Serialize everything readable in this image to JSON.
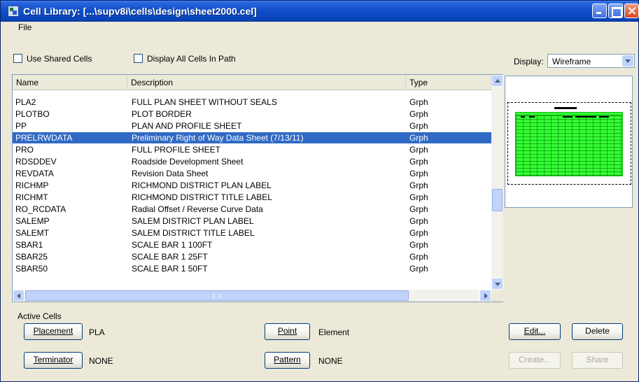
{
  "window": {
    "title": "Cell Library: [...\\supv8i\\cells\\design\\sheet2000.cel]"
  },
  "menu": {
    "file": "File"
  },
  "options": {
    "use_shared_cells": "Use Shared Cells",
    "display_all_cells": "Display All Cells In Path"
  },
  "display": {
    "label": "Display:",
    "value": "Wireframe"
  },
  "list": {
    "columns": {
      "name": "Name",
      "description": "Description",
      "type": "Type"
    },
    "rows": [
      {
        "name": "PLA2",
        "description": "FULL PLAN SHEET WITHOUT SEALS",
        "type": "Grph"
      },
      {
        "name": "PLOTBO",
        "description": "PLOT BORDER",
        "type": "Grph"
      },
      {
        "name": "PP",
        "description": "PLAN AND PROFILE SHEET",
        "type": "Grph"
      },
      {
        "name": "PRELRWDATA",
        "description": "Preliminary Right of Way Data Sheet    (7/13/11)",
        "type": "Grph",
        "selected": true
      },
      {
        "name": "PRO",
        "description": "FULL PROFILE SHEET",
        "type": "Grph"
      },
      {
        "name": "RDSDDEV",
        "description": "Roadside Development Sheet",
        "type": "Grph"
      },
      {
        "name": "REVDATA",
        "description": "Revision Data Sheet",
        "type": "Grph"
      },
      {
        "name": "RICHMP",
        "description": "RICHMOND DISTRICT PLAN LABEL",
        "type": "Grph"
      },
      {
        "name": "RICHMT",
        "description": "RICHMOND DISTRICT TITLE LABEL",
        "type": "Grph"
      },
      {
        "name": "RO_RCDATA",
        "description": "Radial Offset / Reverse Curve Data",
        "type": "Grph"
      },
      {
        "name": "SALEMP",
        "description": "SALEM DISTRICT PLAN LABEL",
        "type": "Grph"
      },
      {
        "name": "SALEMT",
        "description": "SALEM DISTRICT TITLE LABEL",
        "type": "Grph"
      },
      {
        "name": "SBAR1",
        "description": "SCALE BAR 1 100FT",
        "type": "Grph"
      },
      {
        "name": "SBAR25",
        "description": "SCALE BAR 1 25FT",
        "type": "Grph"
      },
      {
        "name": "SBAR50",
        "description": "SCALE BAR 1 50FT",
        "type": "Grph"
      }
    ]
  },
  "active_cells": {
    "label": "Active Cells",
    "placement": {
      "button": "Placement",
      "value": "PLA"
    },
    "terminator": {
      "button": "Terminator",
      "value": "NONE"
    },
    "point": {
      "button": "Point",
      "value": "Element"
    },
    "pattern": {
      "button": "Pattern",
      "value": "NONE"
    }
  },
  "actions": {
    "edit": "Edit...",
    "delete": "Delete",
    "create": "Create...",
    "share": "Share"
  },
  "colors": {
    "titlebar": "#0a44b8",
    "selection": "#316ac5",
    "preview_fill": "#33ff33"
  }
}
